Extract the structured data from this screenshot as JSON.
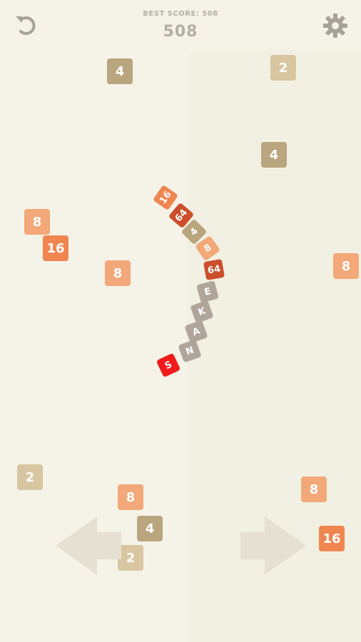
{
  "hud": {
    "best_score_label": "BEST SCORE: 508",
    "score": "508",
    "undo_icon": "undo-icon",
    "settings_icon": "gear-icon"
  },
  "colors": {
    "background": "#f5f3e8",
    "tile_2": "#d7c6a0",
    "tile_4": "#b9a57e",
    "tile_8": "#f2a878",
    "tile_16": "#ef8650",
    "tile_64": "#cc4e2a",
    "snake_head": "#f01c1c",
    "snake_letter": "#b0a59b",
    "arrow": "#e6e0d3"
  },
  "tiles": [
    {
      "value": "4"
    },
    {
      "value": "2"
    },
    {
      "value": "4"
    },
    {
      "value": "8"
    },
    {
      "value": "16"
    },
    {
      "value": "8"
    },
    {
      "value": "8"
    },
    {
      "value": "2"
    },
    {
      "value": "8"
    },
    {
      "value": "8"
    },
    {
      "value": "4"
    },
    {
      "value": "2"
    },
    {
      "value": "16"
    }
  ],
  "snake": [
    {
      "text": "S",
      "kind": "head"
    },
    {
      "text": "N",
      "kind": "letter"
    },
    {
      "text": "A",
      "kind": "letter"
    },
    {
      "text": "K",
      "kind": "letter"
    },
    {
      "text": "E",
      "kind": "letter"
    },
    {
      "text": "64",
      "kind": "tile_64"
    },
    {
      "text": "8",
      "kind": "tile_8"
    },
    {
      "text": "4",
      "kind": "tile_4"
    },
    {
      "text": "64",
      "kind": "tile_64"
    },
    {
      "text": "16",
      "kind": "tile_16"
    }
  ],
  "controls": {
    "left_icon": "arrow-left-icon",
    "right_icon": "arrow-right-icon"
  }
}
